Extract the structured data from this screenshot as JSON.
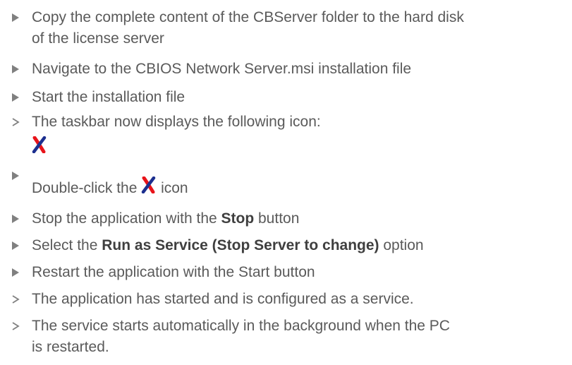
{
  "steps": [
    {
      "type": "action",
      "parts": [
        {
          "t": "Copy the complete content of the CBServer folder to the hard disk"
        }
      ],
      "line2": "of the license server"
    },
    {
      "type": "action",
      "parts": [
        {
          "t": "Navigate to the CBIOS Network Server.msi installation file"
        }
      ]
    },
    {
      "type": "action",
      "parts": [
        {
          "t": "Start the installation file"
        }
      ]
    },
    {
      "type": "result",
      "parts": [
        {
          "t": "The taskbar now displays the following icon:"
        }
      ]
    },
    {
      "type": "action",
      "pre": "Double-click the ",
      "post": " icon"
    },
    {
      "type": "action",
      "s6_a": "Stop the application with the ",
      "s6_b": "Stop",
      "s6_c": " button"
    },
    {
      "type": "action",
      "s7_a": "Select the ",
      "s7_b": "Run as Service (Stop Server to change)",
      "s7_c": " option"
    },
    {
      "type": "action",
      "parts": [
        {
          "t": "Restart the application with the Start button"
        }
      ]
    },
    {
      "type": "result",
      "parts": [
        {
          "t": "The application has started and is configured as a service."
        }
      ]
    },
    {
      "type": "result",
      "parts": [
        {
          "t": "The service starts automatically in the background when the PC"
        }
      ],
      "line2": "is restarted."
    }
  ],
  "icons": {
    "action_marker": "triangle-right-icon",
    "result_marker": "chevron-right-icon",
    "server_icon": "red-blue-x-icon"
  },
  "colors": {
    "text": "#5a5a5a",
    "marker": "#808080",
    "x_red": "#e8141a",
    "x_blue": "#1c2f8f"
  }
}
